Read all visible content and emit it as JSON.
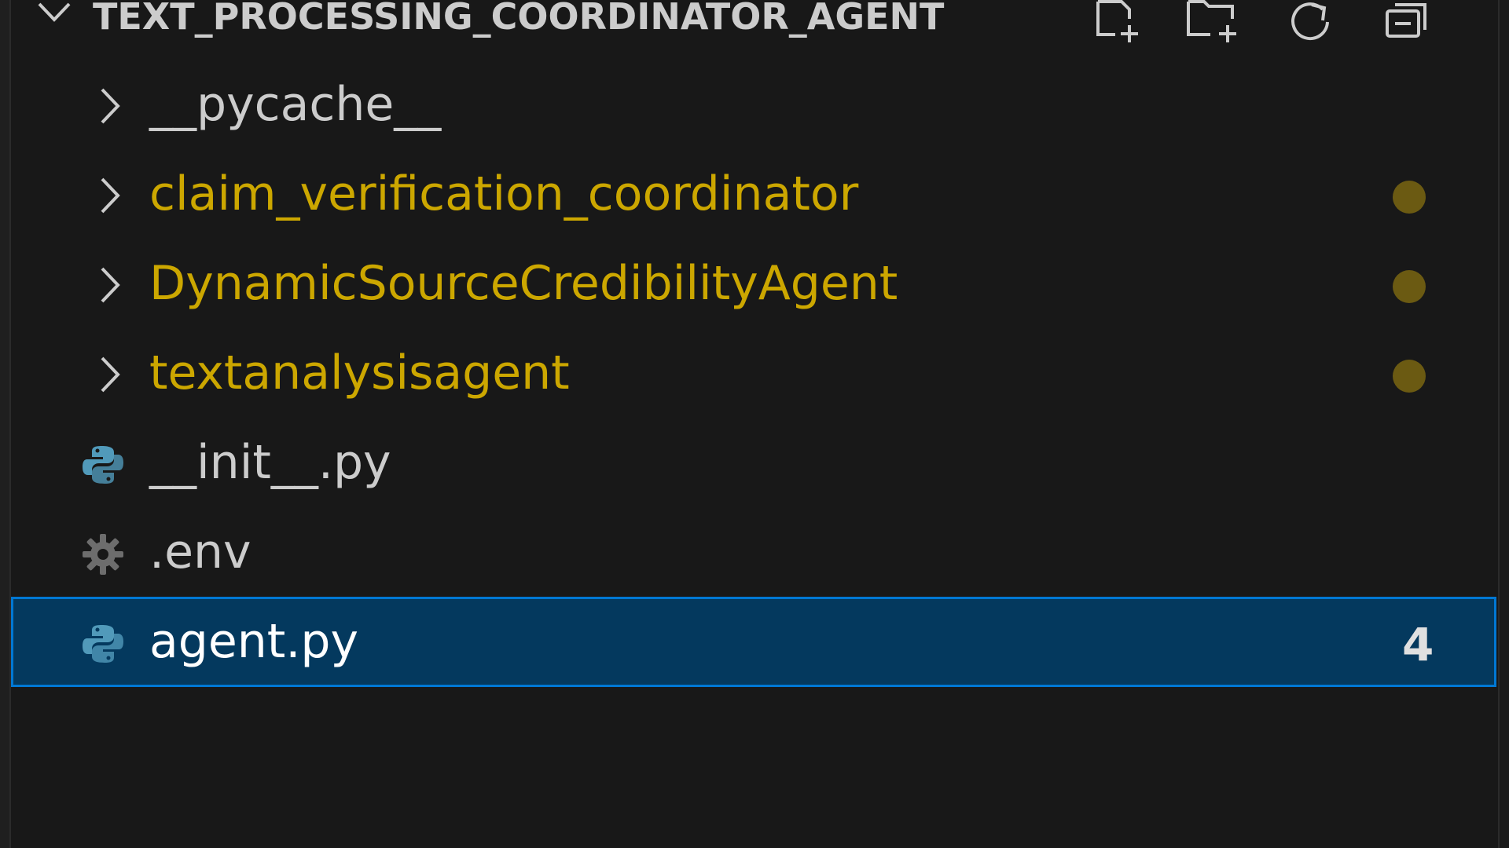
{
  "explorer": {
    "folder_title": "TEXT_PROCESSING_COORDINATOR_AGENT",
    "actions": [
      {
        "icon": "new-file-icon"
      },
      {
        "icon": "new-folder-icon"
      },
      {
        "icon": "refresh-icon"
      },
      {
        "icon": "collapse-all-icon"
      }
    ],
    "items": [
      {
        "label": "__pycache__",
        "type": "folder",
        "color": "#cccccc",
        "status": ""
      },
      {
        "label": "claim_verification_coordinator",
        "type": "folder",
        "color": "#cca700",
        "status": "modified"
      },
      {
        "label": "DynamicSourceCredibilityAgent",
        "type": "folder",
        "color": "#cca700",
        "status": "modified"
      },
      {
        "label": "textanalysisagent",
        "type": "folder",
        "color": "#cca700",
        "status": "modified"
      },
      {
        "label": "__init__.py",
        "type": "python-file",
        "color": "#cccccc",
        "status": ""
      },
      {
        "label": ".env",
        "type": "config-file",
        "color": "#cccccc",
        "status": ""
      },
      {
        "label": "agent.py",
        "type": "python-file",
        "color": "#ffffff",
        "status": "selected",
        "problems": "4"
      }
    ]
  },
  "colors": {
    "background": "#181818",
    "modified_text": "#cca700",
    "modified_dot": "#6b5a12",
    "selection_bg": "#04395e",
    "selection_border": "#0078d4",
    "python_icon": "#519aba"
  }
}
